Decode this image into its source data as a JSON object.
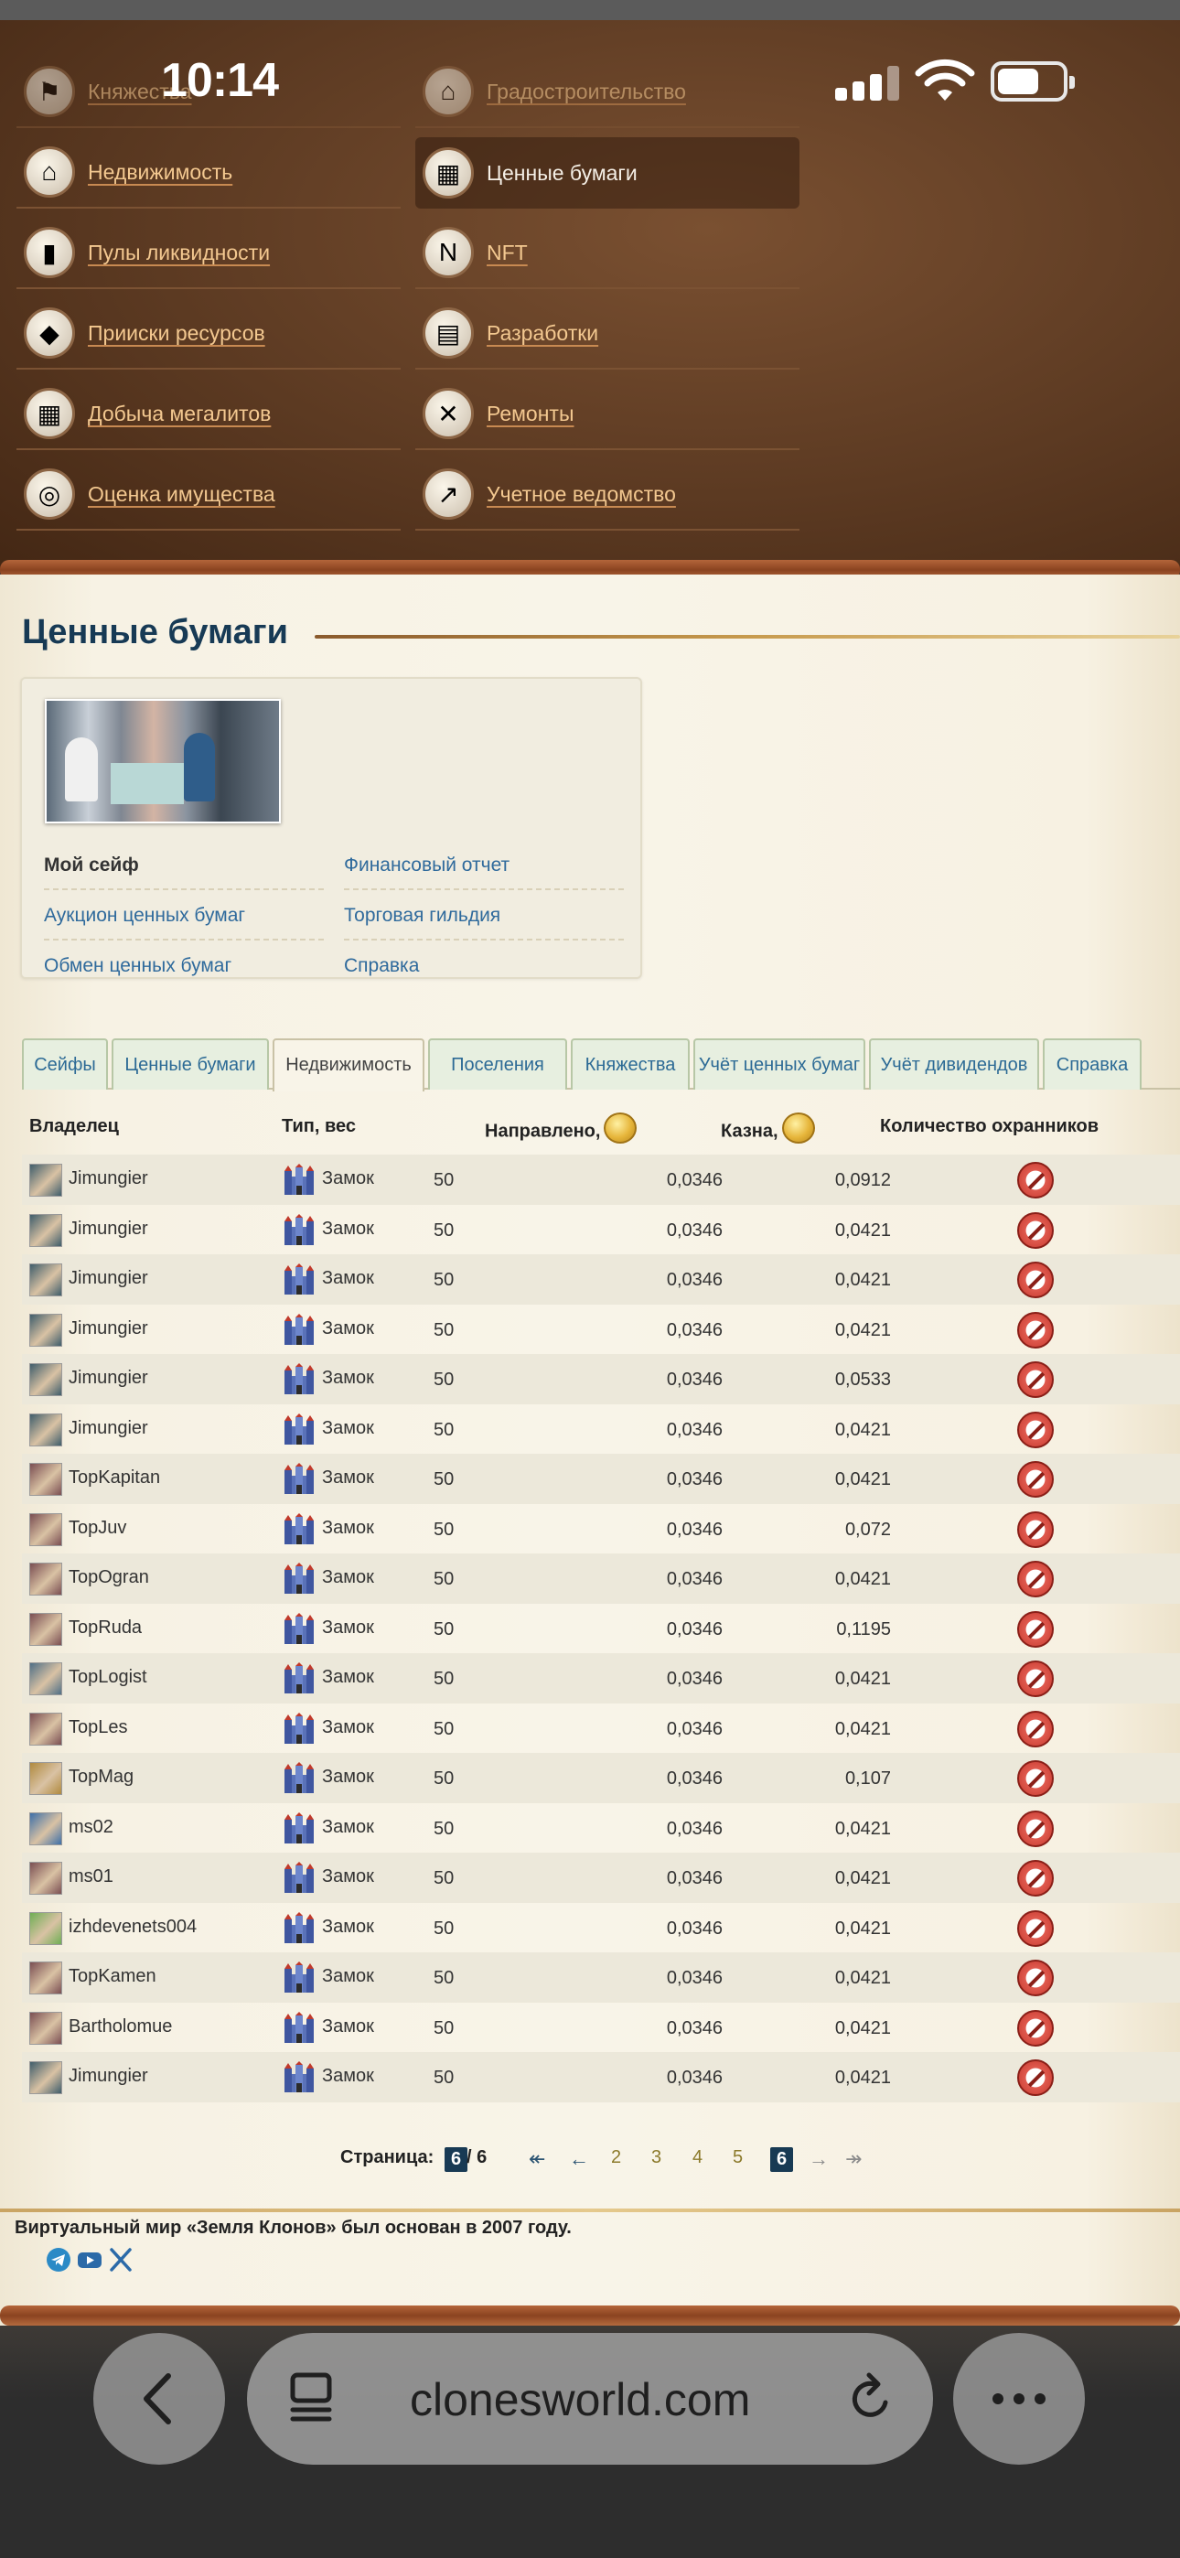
{
  "status": {
    "time": "10:14"
  },
  "nav": {
    "items": [
      {
        "label": "Княжества",
        "icon": "flag-icon",
        "glyph": "⚑"
      },
      {
        "label": "Градостроительство",
        "icon": "city-icon",
        "glyph": "⌂"
      },
      {
        "label": "Недвижимость",
        "icon": "house-icon",
        "glyph": "⌂"
      },
      {
        "label": "Ценные бумаги",
        "icon": "securities-icon",
        "glyph": "▦"
      },
      {
        "label": "Пулы ликвидности",
        "icon": "bars-chart-icon",
        "glyph": "▮"
      },
      {
        "label": "NFT",
        "icon": "nft-icon",
        "glyph": "N"
      },
      {
        "label": "Прииски ресурсов",
        "icon": "ruby-icon",
        "glyph": "◆"
      },
      {
        "label": "Разработки",
        "icon": "factory-icon",
        "glyph": "▤"
      },
      {
        "label": "Добыча мегалитов",
        "icon": "bricks-icon",
        "glyph": "▦"
      },
      {
        "label": "Ремонты",
        "icon": "tools-icon",
        "glyph": "✕"
      },
      {
        "label": "Оценка имущества",
        "icon": "coins-icon",
        "glyph": "◎"
      },
      {
        "label": "Учетное ведомство",
        "icon": "growth-chart-icon",
        "glyph": "↗"
      }
    ]
  },
  "page": {
    "title": "Ценные бумаги"
  },
  "card": {
    "links": [
      {
        "label": "Мой сейф"
      },
      {
        "label": "Финансовый отчет"
      },
      {
        "label": "Аукцион ценных бумаг"
      },
      {
        "label": "Торговая гильдия"
      },
      {
        "label": "Обмен ценных бумаг"
      },
      {
        "label": "Справка"
      }
    ]
  },
  "tabs": [
    {
      "label": "Сейфы"
    },
    {
      "label": "Ценные бумаги"
    },
    {
      "label": "Недвижимость"
    },
    {
      "label": "Поселения"
    },
    {
      "label": "Княжества"
    },
    {
      "label": "Учёт ценных бумаг"
    },
    {
      "label": "Учёт дивидендов"
    },
    {
      "label": "Справка"
    }
  ],
  "table": {
    "headers": {
      "owner": "Владелец",
      "type": "Тип, вес",
      "directed": "Направлено,",
      "treasury": "Казна,",
      "guards": "Количество охранников"
    },
    "rows": [
      {
        "owner": "Jimungier",
        "type": "Замок",
        "weight": "50",
        "directed": "0,0346",
        "treasury": "0,0912",
        "avatar": "#3f5d6b"
      },
      {
        "owner": "Jimungier",
        "type": "Замок",
        "weight": "50",
        "directed": "0,0346",
        "treasury": "0,0421",
        "avatar": "#3f5d6b"
      },
      {
        "owner": "Jimungier",
        "type": "Замок",
        "weight": "50",
        "directed": "0,0346",
        "treasury": "0,0421",
        "avatar": "#3f5d6b"
      },
      {
        "owner": "Jimungier",
        "type": "Замок",
        "weight": "50",
        "directed": "0,0346",
        "treasury": "0,0421",
        "avatar": "#3f5d6b"
      },
      {
        "owner": "Jimungier",
        "type": "Замок",
        "weight": "50",
        "directed": "0,0346",
        "treasury": "0,0533",
        "avatar": "#3f5d6b"
      },
      {
        "owner": "Jimungier",
        "type": "Замок",
        "weight": "50",
        "directed": "0,0346",
        "treasury": "0,0421",
        "avatar": "#3f5d6b"
      },
      {
        "owner": "TopKapitan",
        "type": "Замок",
        "weight": "50",
        "directed": "0,0346",
        "treasury": "0,0421",
        "avatar": "#7a4e52"
      },
      {
        "owner": "TopJuv",
        "type": "Замок",
        "weight": "50",
        "directed": "0,0346",
        "treasury": "0,072",
        "avatar": "#7a4e52"
      },
      {
        "owner": "TopOgran",
        "type": "Замок",
        "weight": "50",
        "directed": "0,0346",
        "treasury": "0,0421",
        "avatar": "#7a4e52"
      },
      {
        "owner": "TopRuda",
        "type": "Замок",
        "weight": "50",
        "directed": "0,0346",
        "treasury": "0,1195",
        "avatar": "#7a4e52"
      },
      {
        "owner": "TopLogist",
        "type": "Замок",
        "weight": "50",
        "directed": "0,0346",
        "treasury": "0,0421",
        "avatar": "#4f6f86"
      },
      {
        "owner": "TopLes",
        "type": "Замок",
        "weight": "50",
        "directed": "0,0346",
        "treasury": "0,0421",
        "avatar": "#7a4e52"
      },
      {
        "owner": "TopMag",
        "type": "Замок",
        "weight": "50",
        "directed": "0,0346",
        "treasury": "0,107",
        "avatar": "#b08a3e"
      },
      {
        "owner": "ms02",
        "type": "Замок",
        "weight": "50",
        "directed": "0,0346",
        "treasury": "0,0421",
        "avatar": "#3d6fa8"
      },
      {
        "owner": "ms01",
        "type": "Замок",
        "weight": "50",
        "directed": "0,0346",
        "treasury": "0,0421",
        "avatar": "#7a4e52"
      },
      {
        "owner": "izhdevenets004",
        "type": "Замок",
        "weight": "50",
        "directed": "0,0346",
        "treasury": "0,0421",
        "avatar": "#6fae54"
      },
      {
        "owner": "TopKamen",
        "type": "Замок",
        "weight": "50",
        "directed": "0,0346",
        "treasury": "0,0421",
        "avatar": "#7a4e52"
      },
      {
        "owner": "Bartholomue",
        "type": "Замок",
        "weight": "50",
        "directed": "0,0346",
        "treasury": "0,0421",
        "avatar": "#7a4e52"
      },
      {
        "owner": "Jimungier",
        "type": "Замок",
        "weight": "50",
        "directed": "0,0346",
        "treasury": "0,0421",
        "avatar": "#3f5d6b"
      }
    ]
  },
  "pager": {
    "label": "Страница:",
    "current": "6",
    "total": "/ 6",
    "first": "↞",
    "prev": "←",
    "pages": [
      "2",
      "3",
      "4",
      "5"
    ],
    "active": "6",
    "next": "→",
    "last": "↠"
  },
  "footer": {
    "text": "Виртуальный мир «Земля Клонов» был основан в 2007 году."
  },
  "browser": {
    "url": "clonesworld.com"
  }
}
